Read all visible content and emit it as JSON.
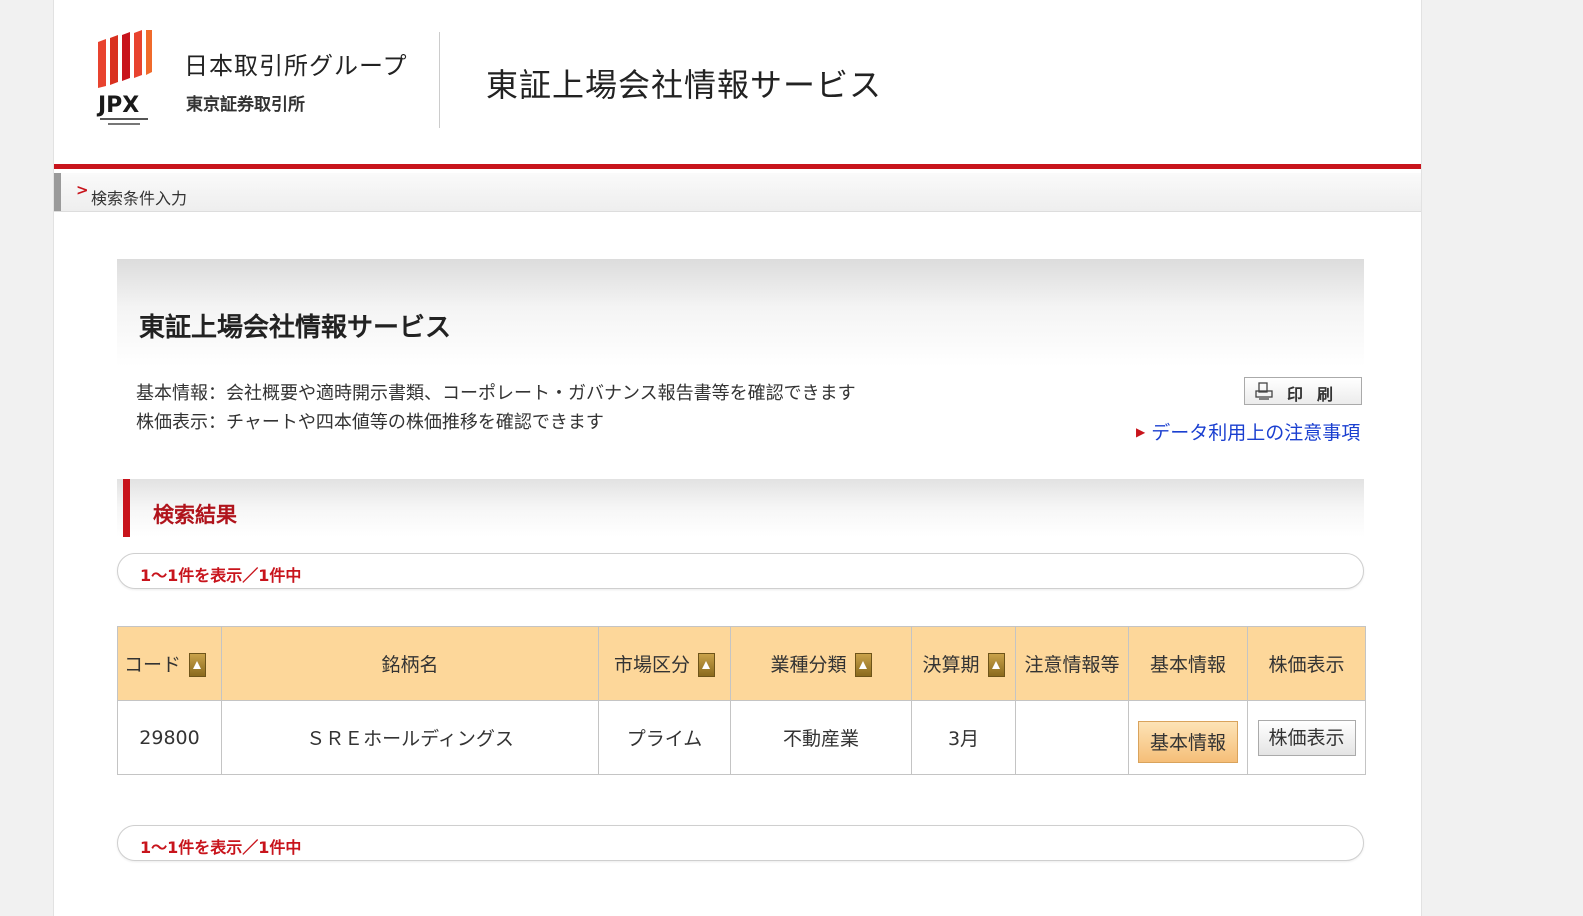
{
  "header": {
    "logo_text": "JPX",
    "group_name": "日本取引所グループ",
    "exchange_name": "東京証券取引所",
    "service_title": "東証上場会社情報サービス"
  },
  "breadcrumb": {
    "label": "検索条件入力"
  },
  "panel": {
    "title": "東証上場会社情報サービス",
    "desc_1": "基本情報：会社概要や適時開示書類、コーポレート・ガバナンス報告書等を確認できます",
    "desc_2": "株価表示：チャートや四本値等の株価推移を確認できます",
    "print_label": "印刷",
    "notice_link": "データ利用上の注意事項"
  },
  "results": {
    "heading": "検索結果",
    "count_text": "1～1件を表示／1件中",
    "columns": [
      "コード",
      "銘柄名",
      "市場区分",
      "業種分類",
      "決算期",
      "注意情報等",
      "基本情報",
      "株価表示"
    ],
    "rows": [
      {
        "code": "29800",
        "name": "ＳＲＥホールディングス",
        "market": "プライム",
        "industry": "不動産業",
        "fiscal": "3月",
        "notice": "",
        "basic_button": "基本情報",
        "stock_button": "株価表示"
      }
    ]
  },
  "colors": {
    "accent_red": "#c8141c",
    "header_orange": "#fdd79a",
    "link_blue": "#1a3fd0"
  },
  "icons": {
    "sort": "sort-up-icon",
    "print": "printer-icon",
    "breadcrumb": "chevron-right-icon",
    "notice": "triangle-right-icon"
  }
}
